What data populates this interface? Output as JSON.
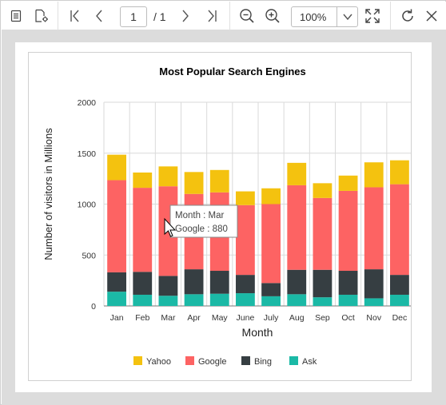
{
  "toolbar": {
    "current_page": "1",
    "total_pages": "/ 1",
    "zoom_level": "100%",
    "icons": [
      "document-icon",
      "settings-document-icon",
      "first-page-icon",
      "previous-page-icon",
      "next-page-icon",
      "last-page-icon",
      "zoom-out-icon",
      "zoom-in-icon",
      "dropdown-chevron-icon",
      "fit-page-icon",
      "refresh-icon",
      "close-icon"
    ]
  },
  "tooltip": {
    "line1": "Month : Mar",
    "line2": "Google : 880"
  },
  "chart_data": {
    "type": "bar",
    "stacked": true,
    "title": "Most Popular Search Engines",
    "xlabel": "Month",
    "ylabel": "Number of visitors in Millions",
    "ylim": [
      0,
      2000
    ],
    "yticks": [
      "0",
      "500",
      "1000",
      "1500",
      "2000"
    ],
    "grid": true,
    "legend_position": "bottom",
    "categories": [
      "Jan",
      "Feb",
      "Mar",
      "Apr",
      "May",
      "June",
      "July",
      "Aug",
      "Sep",
      "Oct",
      "Nov",
      "Dec"
    ],
    "series": [
      {
        "name": "Ask",
        "color": "#1bb9a6",
        "values": [
          140,
          110,
          100,
          115,
          120,
          125,
          95,
          115,
          85,
          110,
          75,
          110
        ]
      },
      {
        "name": "Bing",
        "color": "#363e42",
        "values": [
          190,
          225,
          195,
          245,
          225,
          180,
          130,
          240,
          270,
          235,
          285,
          195
        ]
      },
      {
        "name": "Google",
        "color": "#fd6363",
        "values": [
          905,
          825,
          880,
          740,
          770,
          685,
          775,
          830,
          705,
          785,
          805,
          890
        ]
      },
      {
        "name": "Yahoo",
        "color": "#f4c20f",
        "values": [
          250,
          150,
          195,
          215,
          220,
          135,
          155,
          220,
          145,
          150,
          245,
          235
        ]
      }
    ],
    "legend_order": [
      "Yahoo",
      "Google",
      "Bing",
      "Ask"
    ]
  }
}
